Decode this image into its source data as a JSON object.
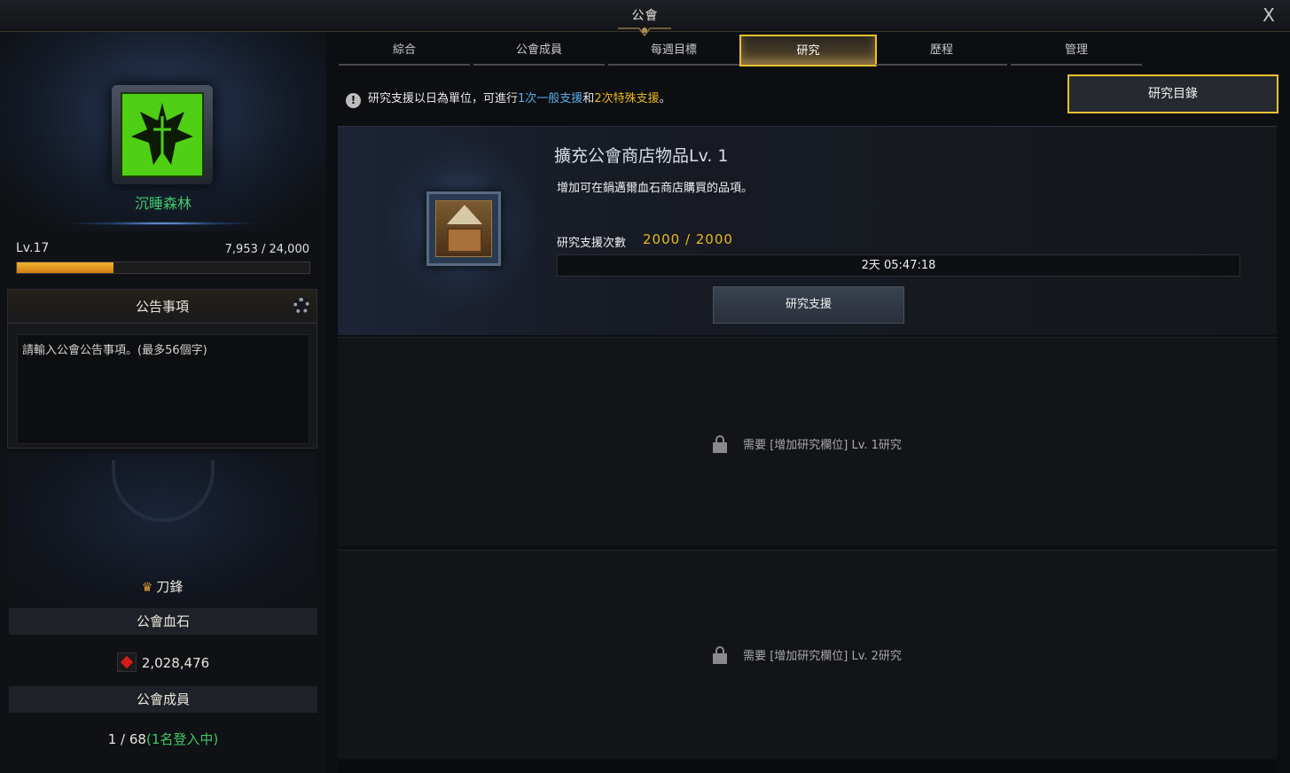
{
  "window": {
    "title": "公會",
    "close_label": "X"
  },
  "left": {
    "guild_name": "沉睡森林",
    "level": "Lv.17",
    "exp_text": "7,953 / 24,000",
    "exp_fraction": 0.33,
    "notice_title": "公告事項",
    "notice_placeholder": "請輸入公會公告事項。(最多56個字)",
    "master_name": "刀鋒",
    "bloodstone_title": "公會血石",
    "bloodstone_value": "2,028,476",
    "members_title": "公會成員",
    "members_count": "1 / 68",
    "members_online": "(1名登入中)"
  },
  "tabs": [
    {
      "label": "綜合"
    },
    {
      "label": "公會成員"
    },
    {
      "label": "每週目標"
    },
    {
      "label": "研究",
      "active": true
    },
    {
      "label": "歷程"
    },
    {
      "label": "管理"
    }
  ],
  "info": {
    "prefix": "研究支援以日為單位，可進行",
    "normal": "1次一般支援",
    "and": "和",
    "special": "2次特殊支援",
    "suffix": "。"
  },
  "catalog_button": "研究目錄",
  "research": {
    "title": "擴充公會商店物品Lv. 1",
    "description": "增加可在鍋邁爾血石商店購買的品項。",
    "support_label": "研究支援次數",
    "support_count": "2000 / 2000",
    "timer": "2天 05:47:18",
    "support_button": "研究支援"
  },
  "locked_slots": [
    {
      "text": "需要 [增加研究欄位] Lv. 1研究"
    },
    {
      "text": "需要 [增加研究欄位] Lv. 2研究"
    }
  ],
  "colors": {
    "accent_gold": "#e8c030",
    "guild_green": "#3fc868",
    "info_blue": "#5ab0e8",
    "exp_orange": "#e8a020"
  }
}
